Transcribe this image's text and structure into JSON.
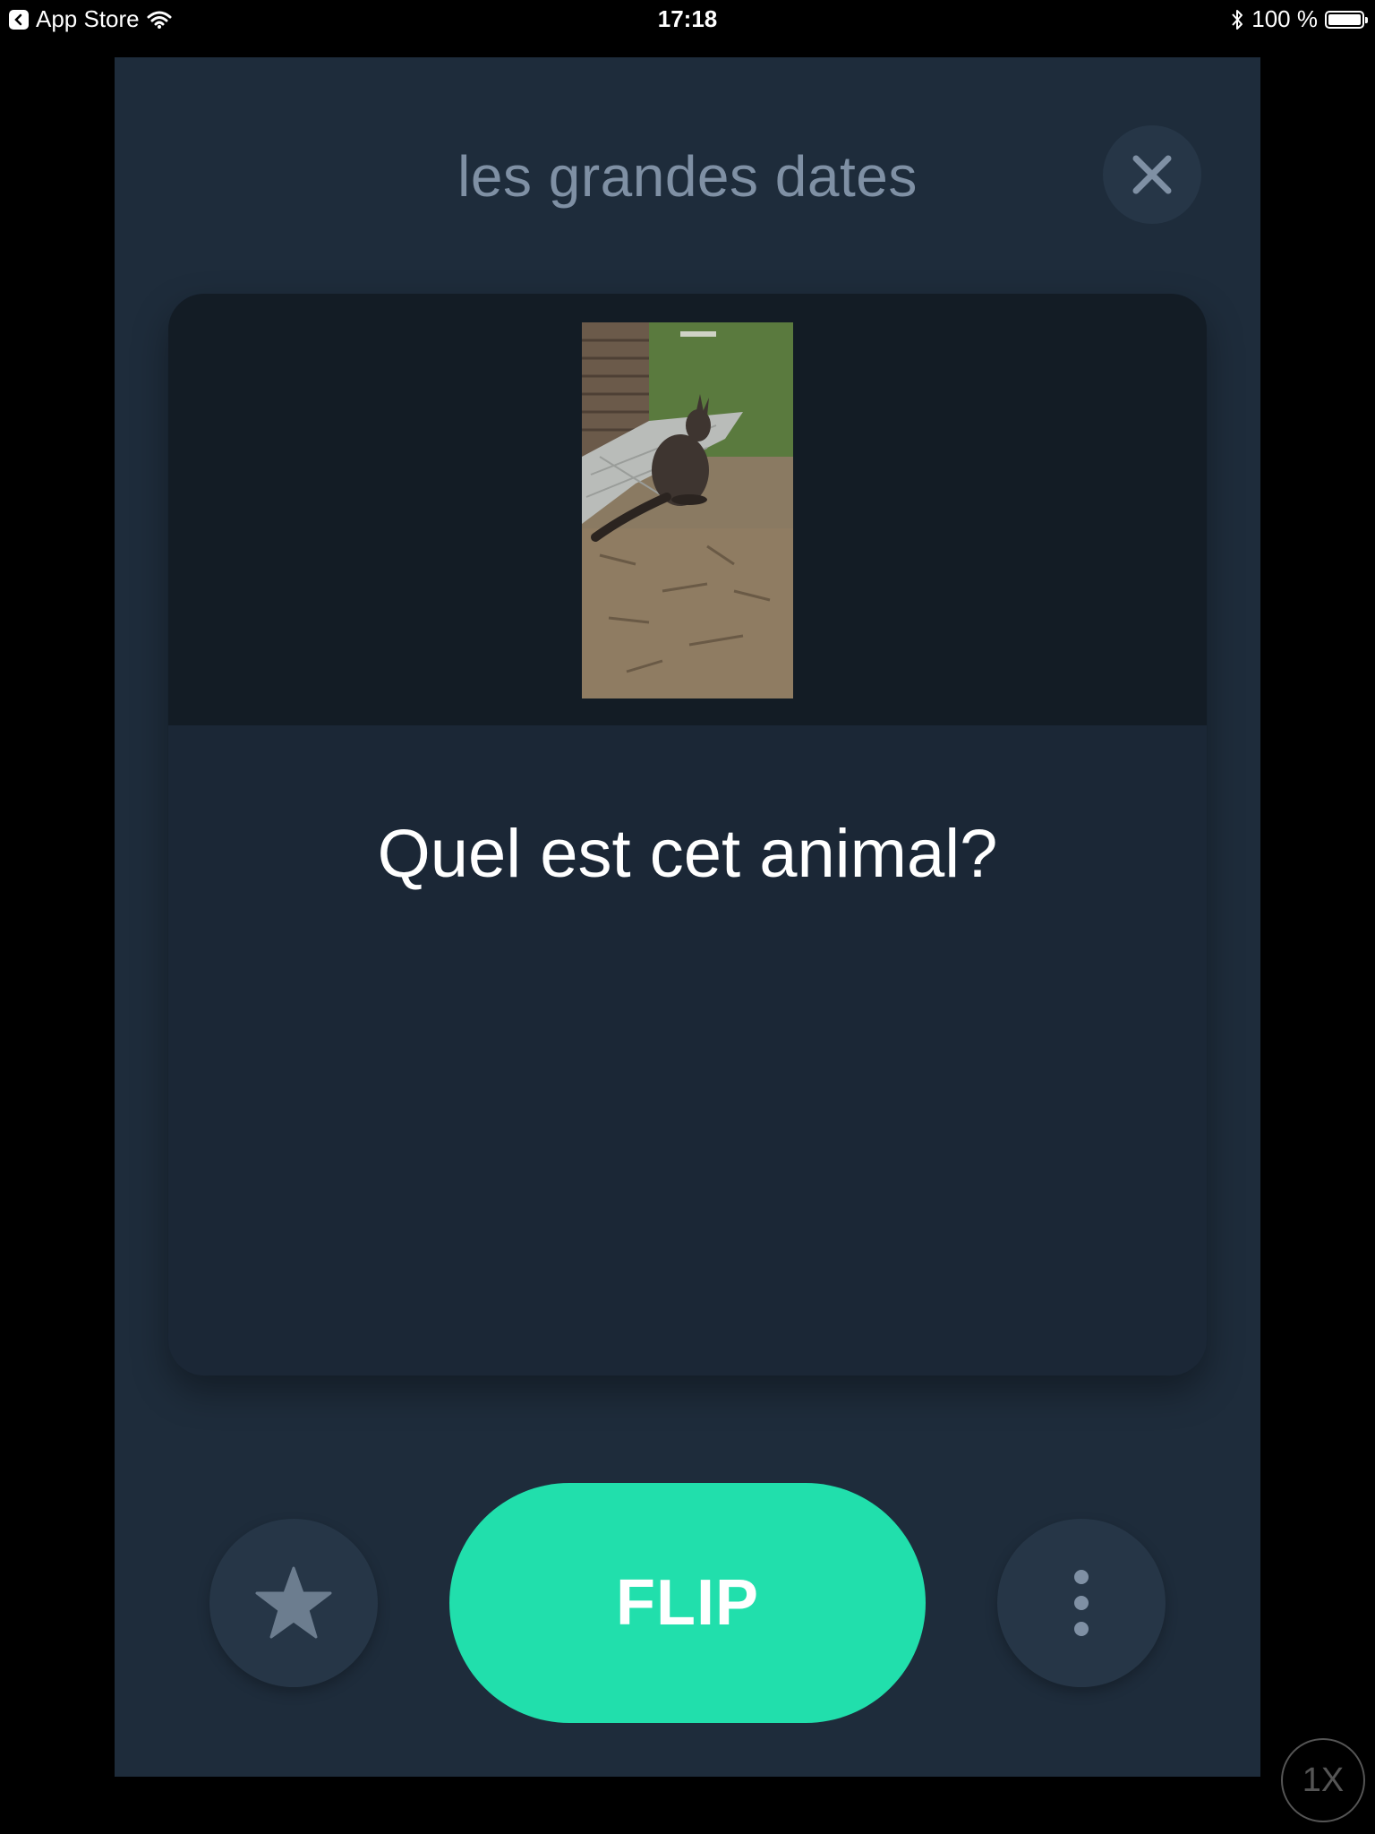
{
  "status_bar": {
    "back_app": "App Store",
    "time": "17:18",
    "battery_text": "100 %",
    "battery_level": 1.0
  },
  "header": {
    "deck_title": "les grandes dates",
    "close_icon": "close-icon"
  },
  "card": {
    "image_icon": "wallaby-photo",
    "question": "Quel est cet animal?"
  },
  "actions": {
    "star_icon": "star-icon",
    "flip_label": "FLIP",
    "more_icon": "more-vertical-icon"
  },
  "overlay": {
    "zoom_label": "1X"
  },
  "colors": {
    "background": "#1e2c3b",
    "card": "#1b2736",
    "accent": "#21dfac",
    "muted_text": "#7f90a4"
  }
}
